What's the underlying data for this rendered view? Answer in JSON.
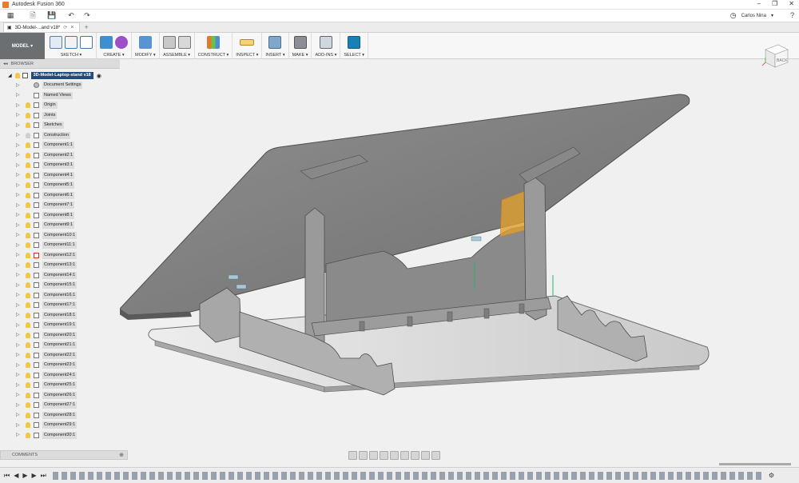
{
  "app": {
    "title": "Autodesk Fusion 360",
    "user": "Carlos Nina"
  },
  "tab": {
    "label": "3D-Model-...and v18*"
  },
  "workspace": {
    "label": "MODEL"
  },
  "ribbon": {
    "groups": [
      {
        "label": "SKETCH ▾"
      },
      {
        "label": "CREATE ▾"
      },
      {
        "label": "MODIFY ▾"
      },
      {
        "label": "ASSEMBLE ▾"
      },
      {
        "label": "CONSTRUCT ▾"
      },
      {
        "label": "INSPECT ▾"
      },
      {
        "label": "INSERT ▾"
      },
      {
        "label": "MAKE ▾"
      },
      {
        "label": "ADD-INS ▾"
      },
      {
        "label": "SELECT ▾"
      }
    ]
  },
  "browser": {
    "header": "BROWSER",
    "root": "3D-Model-Laptop-stand v18",
    "items": [
      "Document Settings",
      "Named Views",
      "Origin",
      "Joints",
      "Sketches",
      "Construction",
      "Component1:1",
      "Component2:1",
      "Component3:1",
      "Component4:1",
      "Component5:1",
      "Component6:1",
      "Component7:1",
      "Component8:1",
      "Component9:1",
      "Component10:1",
      "Component11:1",
      "Component12:1",
      "Component13:1",
      "Component14:1",
      "Component15:1",
      "Component16:1",
      "Component17:1",
      "Component18:1",
      "Component19:1",
      "Component20:1",
      "Component21:1",
      "Component22:1",
      "Component23:1",
      "Component24:1",
      "Component25:1",
      "Component26:1",
      "Component27:1",
      "Component28:1",
      "Component29:1",
      "Component30:1"
    ]
  },
  "comments": {
    "label": "COMMENTS"
  },
  "viewcube": {
    "face": "BACK"
  },
  "colors": {
    "accent": "#1a7fb4",
    "workspace": "#6b6f72",
    "root_highlight": "#1f4c7c",
    "bulb": "#f2c744"
  }
}
